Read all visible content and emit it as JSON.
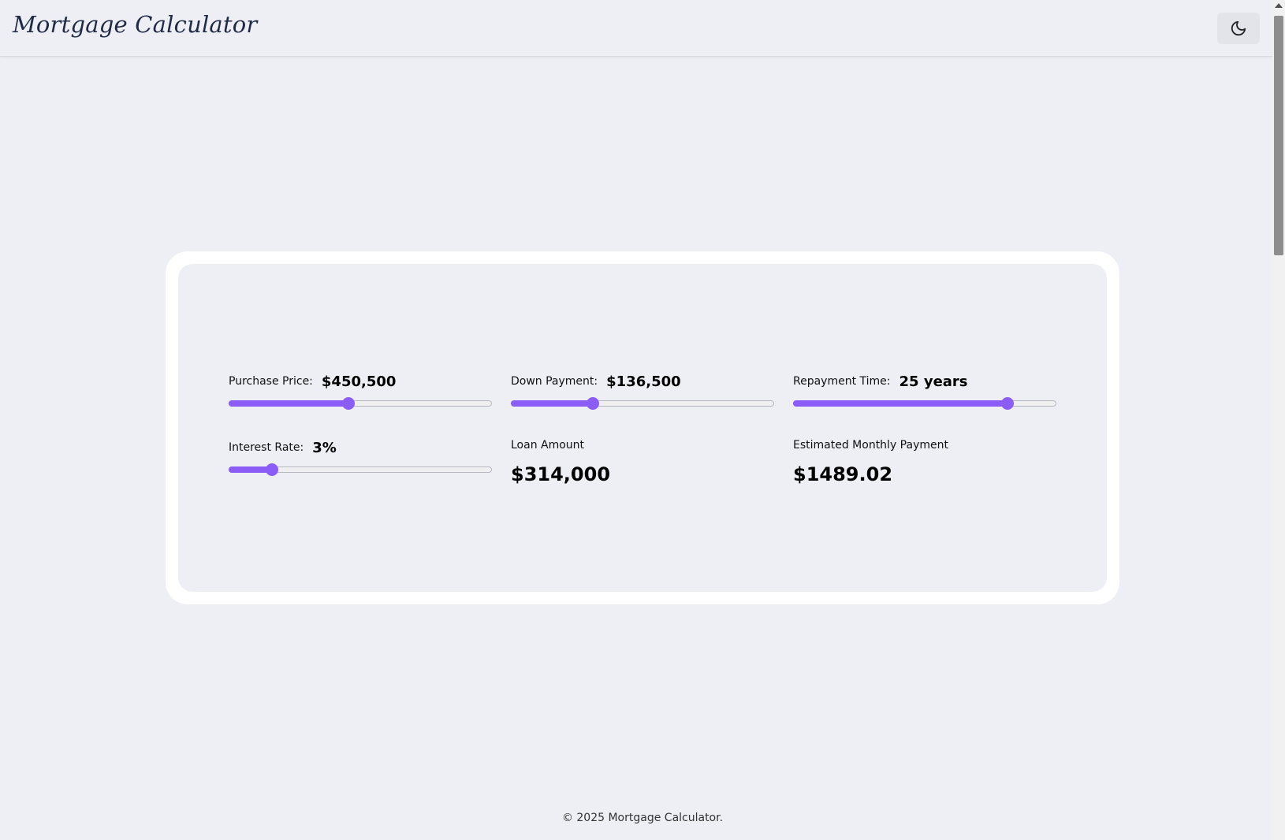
{
  "header": {
    "title": "Mortgage Calculator",
    "theme_toggle_icon": "moon-icon"
  },
  "calculator": {
    "purchase_price": {
      "label": "Purchase Price:",
      "value": "$450,500",
      "slider_fraction": 0.455
    },
    "down_payment": {
      "label": "Down Payment:",
      "value": "$136,500",
      "slider_fraction": 0.31
    },
    "repayment_time": {
      "label": "Repayment Time:",
      "value": "25 years",
      "slider_fraction": 0.815
    },
    "interest_rate": {
      "label": "Interest Rate:",
      "value": "3%",
      "slider_fraction": 0.165
    },
    "loan_amount": {
      "label": "Loan Amount",
      "value": "$314,000"
    },
    "monthly_payment": {
      "label": "Estimated Monthly Payment",
      "value": "$1489.02"
    }
  },
  "footer": {
    "text": "© 2025 Mortgage Calculator."
  },
  "colors": {
    "accent": "#8b5cf6",
    "background": "#eeeef5",
    "card_border": "#ffffff"
  }
}
